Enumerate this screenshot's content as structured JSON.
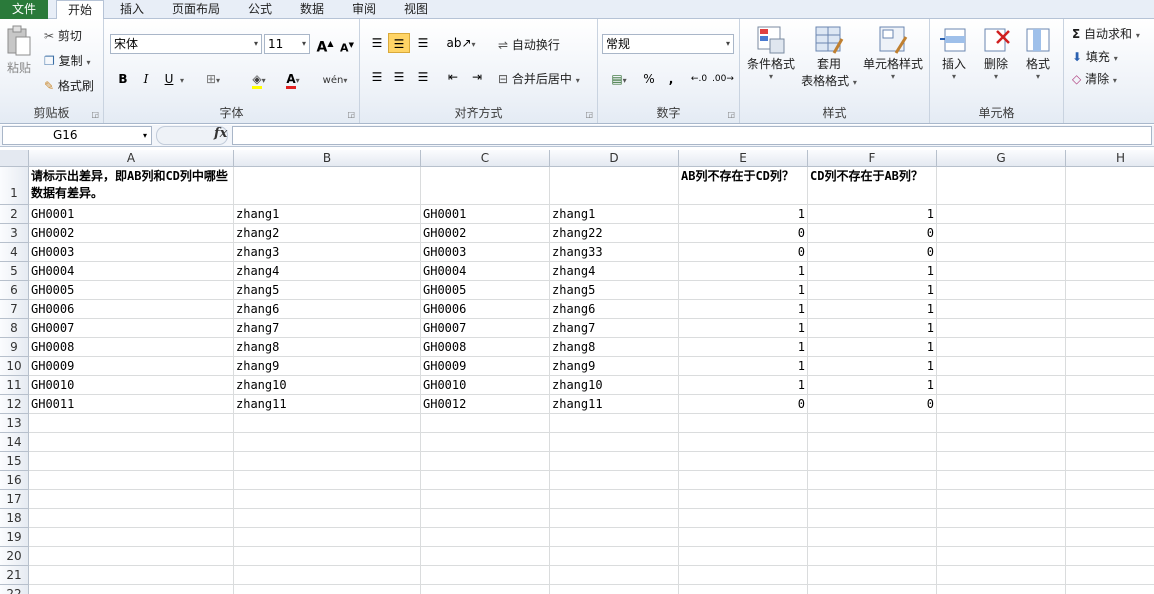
{
  "tabs": [
    "文件",
    "开始",
    "插入",
    "页面布局",
    "公式",
    "数据",
    "审阅",
    "视图"
  ],
  "clipboard": {
    "paste": "粘贴",
    "cut": "剪切",
    "copy": "复制",
    "format_painter": "格式刷",
    "label": "剪贴板"
  },
  "font": {
    "name": "宋体",
    "size": "11",
    "bold": "B",
    "italic": "I",
    "underline": "U",
    "label": "字体"
  },
  "alignment": {
    "wrap_text": "自动换行",
    "merge_center": "合并后居中",
    "label": "对齐方式"
  },
  "number": {
    "format": "常规",
    "percent": "%",
    "comma": ",",
    "label": "数字"
  },
  "styles": {
    "conditional": "条件格式",
    "table_line1": "套用",
    "table_line2": "表格格式",
    "cell_styles": "单元格样式",
    "label": "样式"
  },
  "cells": {
    "insert": "插入",
    "delete": "删除",
    "format": "格式",
    "label": "单元格"
  },
  "editing": {
    "autosum": "自动求和",
    "fill": "填充",
    "clear": "清除"
  },
  "formula_bar": {
    "name_box": "G16",
    "fx": "fx",
    "formula": ""
  },
  "columns": [
    "A",
    "B",
    "C",
    "D",
    "E",
    "F",
    "G",
    "H"
  ],
  "row_numbers": [
    "1",
    "2",
    "3",
    "4",
    "5",
    "6",
    "7",
    "8",
    "9",
    "10",
    "11",
    "12",
    "13",
    "14",
    "15",
    "16",
    "17",
    "18",
    "19",
    "20",
    "21",
    "22"
  ],
  "header_row": {
    "A": "请标示出差异，即AB列和CD列中哪些数据有差异。",
    "E": "AB列不存在于CD列？",
    "F": "CD列不存在于AB列？"
  },
  "rows": [
    [
      "GH0001",
      "zhang1",
      "GH0001",
      "zhang1",
      "1",
      "1"
    ],
    [
      "GH0002",
      "zhang2",
      "GH0002",
      "zhang22",
      "0",
      "0"
    ],
    [
      "GH0003",
      "zhang3",
      "GH0003",
      "zhang33",
      "0",
      "0"
    ],
    [
      "GH0004",
      "zhang4",
      "GH0004",
      "zhang4",
      "1",
      "1"
    ],
    [
      "GH0005",
      "zhang5",
      "GH0005",
      "zhang5",
      "1",
      "1"
    ],
    [
      "GH0006",
      "zhang6",
      "GH0006",
      "zhang6",
      "1",
      "1"
    ],
    [
      "GH0007",
      "zhang7",
      "GH0007",
      "zhang7",
      "1",
      "1"
    ],
    [
      "GH0008",
      "zhang8",
      "GH0008",
      "zhang8",
      "1",
      "1"
    ],
    [
      "GH0009",
      "zhang9",
      "GH0009",
      "zhang9",
      "1",
      "1"
    ],
    [
      "GH0010",
      "zhang10",
      "GH0010",
      "zhang10",
      "1",
      "1"
    ],
    [
      "GH0011",
      "zhang11",
      "GH0012",
      "zhang11",
      "0",
      "0"
    ]
  ]
}
